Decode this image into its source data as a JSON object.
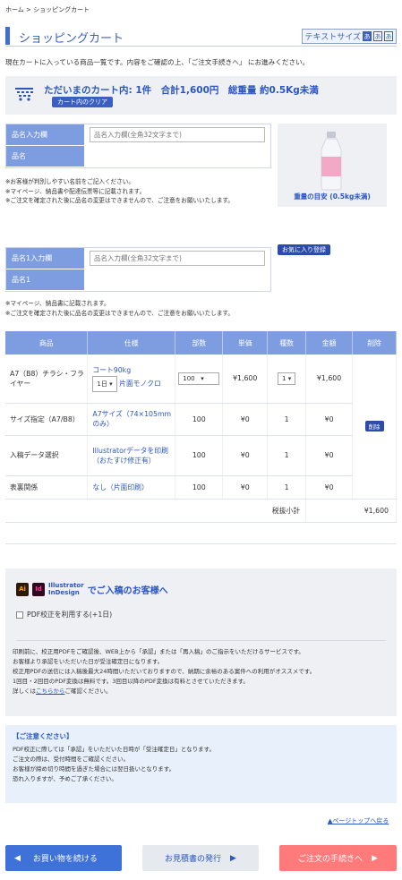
{
  "breadcrumb": {
    "home": "ホーム",
    "sep": ">",
    "current": "ショッピングカート"
  },
  "page_title": "ショッピングカート",
  "text_size": {
    "label": "テキストサイズ",
    "options": [
      "あ",
      "あ",
      "あ"
    ]
  },
  "intro": "現在カートに入っている商品一覧です。内容をご確認の上、「ご注文手続きへ」 にお進みください。",
  "cart_summary": {
    "text": "ただいまのカート内: 1件　合計1,600円　総重量 約0.5Kg未満",
    "clear_button": "カート内のクリア"
  },
  "form1": {
    "label_input": "品名入力欄",
    "placeholder": "品名入力欄(全角32文字まで)",
    "label_name": "品名",
    "notes": [
      "※お客様が判別しやすい名前をご記入ください。",
      "※マイページ、納品書や配達伝票等に記載されます。",
      "※ご注文を確定された後に品名の変更はできませんので、ご注意をお願いいたします。"
    ]
  },
  "weight_guide": "重量の目安 (0.5kg未満)",
  "form2": {
    "label_input": "品名1入力欄",
    "placeholder": "品名入力欄(全角32文字まで)",
    "label_name": "品名1",
    "favorite_button": "お気に入り登録",
    "notes": [
      "※マイページ、納品書に記載されます。",
      "※ご注文を確定された後に品名の変更はできませんので、ご注意をお願いいたします。"
    ]
  },
  "table": {
    "headers": [
      "商品",
      "仕様",
      "部数",
      "単価",
      "種数",
      "金額",
      "削除"
    ],
    "rows": [
      {
        "name": "A7（B8）チラシ・フライヤー",
        "spec_top": "コート90kg",
        "days": "1日",
        "spec_mid": "片面モノクロ",
        "qty": "100",
        "price": "¥1,600",
        "kinds": "1",
        "amount": "¥1,600"
      },
      {
        "name": "サイズ指定（A7/B8）",
        "spec": "A7サイズ（74×105mmのみ）",
        "qty": "100",
        "price": "¥0",
        "kinds": "1",
        "amount": "¥0"
      },
      {
        "name": "入稿データ選択",
        "spec": "Illustratorデータを印刷（おたすけ修正有）",
        "qty": "100",
        "price": "¥0",
        "kinds": "1",
        "amount": "¥0"
      },
      {
        "name": "表裏関係",
        "spec": "なし（片面印刷）",
        "qty": "100",
        "price": "¥0",
        "kinds": "1",
        "amount": "¥0"
      }
    ],
    "delete_button": "削除",
    "subtotal_label": "税抜小計",
    "subtotal": "¥1,600"
  },
  "illustrator": {
    "ai": "Ai",
    "id": "Id",
    "brand_line1": "Illustrator",
    "brand_line2": "InDesign",
    "heading": "でご入稿のお客様へ",
    "checkbox_label": "PDF校正を利用する(+1日)",
    "lines": [
      "印刷前に、校正用PDFをご確認後、WEB上から「承認」または「再入稿」のご指示をいただけるサービスです。",
      "お客様より承認をいただいた日が受注確定日になります。",
      "校正用PDFの送信には入稿後最大24時間いただいておりますので、納期に余裕のある案件への利用がオススメです。",
      "1回目・2回目のPDF変換は無料です。3回目以降のPDF変換は有料とさせていただきます。"
    ],
    "detail_pre": "詳しくは",
    "detail_link": "こちらから",
    "detail_post": "ご確認ください。"
  },
  "caution": {
    "title": "【ご注意ください】",
    "lines": [
      "PDF校正に際しては「承認」をいただいた日時が「受注確定日」となります。",
      "ご注文の際は、受付時間をご確認ください。",
      "お客様が締め切り時間を過ぎた場合には翌日扱いとなります。",
      "恐れ入りますが、予めご了承ください。"
    ]
  },
  "page_top": "▲ページトップへ戻る",
  "buttons": {
    "continue": "お買い物を続ける",
    "estimate": "お見積書の発行",
    "checkout": "ご注文の手続きへ"
  },
  "colors": {
    "accent": "#3f72d9",
    "label_bg": "#7d9de0",
    "checkout": "#ff7b7b",
    "panel": "#eef0f3"
  }
}
